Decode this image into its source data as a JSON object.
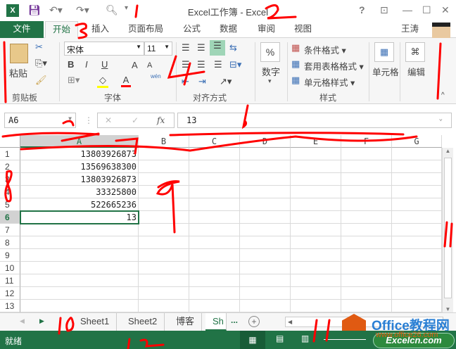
{
  "title": "Excel工作簿 - Excel",
  "quick_access": {
    "save": "save-icon",
    "undo": "undo-icon",
    "redo": "redo-icon",
    "preview": "print-preview-icon",
    "customize": "▾"
  },
  "window_controls": {
    "help": "?",
    "restore_ribbon": "⊡",
    "minimize": "—",
    "maximize": "☐",
    "close": "✕"
  },
  "tabs": [
    {
      "label": "文件"
    },
    {
      "label": "开始"
    },
    {
      "label": "插入"
    },
    {
      "label": "页面布局"
    },
    {
      "label": "公式"
    },
    {
      "label": "数据"
    },
    {
      "label": "审阅"
    },
    {
      "label": "视图"
    }
  ],
  "user": {
    "name": "王涛"
  },
  "ribbon": {
    "clipboard": {
      "label": "剪贴板",
      "paste": "粘贴"
    },
    "font": {
      "label": "字体",
      "name": "宋体",
      "size": "11",
      "bold": "B",
      "italic": "I",
      "underline": "U",
      "grow": "A",
      "shrink": "A",
      "color": "A",
      "phonetic": "wén"
    },
    "alignment": {
      "label": "对齐方式"
    },
    "number": {
      "label": "数字",
      "symbol": "%"
    },
    "styles": {
      "label": "样式",
      "conditional": "条件格式",
      "table": "套用表格格式",
      "cell_styles": "单元格样式"
    },
    "cells": {
      "label": "单元格"
    },
    "editing": {
      "label": "编辑"
    }
  },
  "formula_bar": {
    "name_box": "A6",
    "cancel": "✕",
    "enter": "✓",
    "fx": "fx",
    "value": "13"
  },
  "columns": [
    "A",
    "B",
    "C",
    "D",
    "E",
    "F",
    "G"
  ],
  "rows": [
    "1",
    "2",
    "3",
    "4",
    "5",
    "6",
    "7",
    "8",
    "9",
    "10",
    "11",
    "12",
    "13"
  ],
  "cells_A": [
    "13803926873",
    "13569638300",
    "13803926873",
    "33325800",
    "522665236",
    "13"
  ],
  "active_cell": "A6",
  "sheets": [
    {
      "label": "Sheet1"
    },
    {
      "label": "Sheet2"
    },
    {
      "label": "博客"
    },
    {
      "label": "Sh"
    }
  ],
  "sheet_more": "...",
  "status": {
    "text": "就绪"
  },
  "watermark": {
    "brand": "Office教程网",
    "url": "www.office26.com",
    "site": "Excelcn.com"
  },
  "annotations": [
    "1",
    "2",
    "3",
    "4",
    "5",
    "6",
    "7",
    "8",
    "9",
    "10",
    "11",
    "12"
  ],
  "colors": {
    "accent": "#217346",
    "annotation": "#ff0000"
  }
}
